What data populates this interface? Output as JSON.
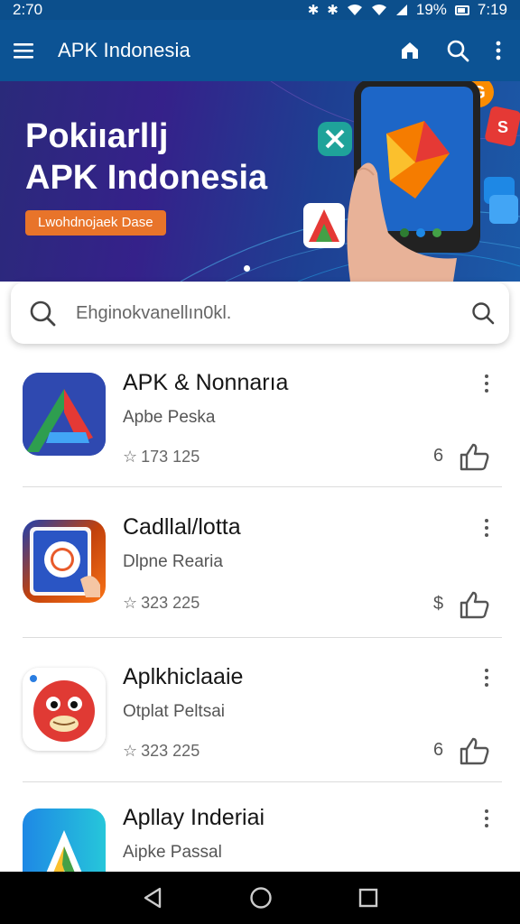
{
  "status_bar": {
    "time": "2:70",
    "battery_percent": "19%",
    "clock_right": "7:19"
  },
  "app_bar": {
    "title": "APK Indonesia"
  },
  "banner": {
    "title_line1": "Pokiıarllj",
    "title_line2": "APK Indonesia",
    "cta_label": "Lwohdnojaek Dase"
  },
  "search": {
    "placeholder": "Ehginokvanellın0kl."
  },
  "apps": [
    {
      "name": "APK & Nonnarıa",
      "developer": "Apbe Peska",
      "rating": "173 125",
      "price": "6",
      "icon": "geometric-a-icon"
    },
    {
      "name": "Cadllal/lotta",
      "developer": "Dlpne Rearia",
      "rating": "323 225",
      "price": "$",
      "icon": "camera-app-icon"
    },
    {
      "name": "Aplkhiclaaie",
      "developer": "Otplat Peltsai",
      "rating": "323 225",
      "price": "6",
      "icon": "red-bird-icon"
    },
    {
      "name": "Apllay Inderiai",
      "developer": "Aipke Passal",
      "rating": "",
      "price": "",
      "icon": "triangle-a-icon"
    }
  ],
  "colors": {
    "app_bar": "#0c5394",
    "cta": "#e8742a",
    "banner_start": "#2a2a7a",
    "banner_end": "#1b5aa8"
  },
  "nav": {
    "back": "back-icon",
    "home": "home-icon",
    "recents": "recents-icon"
  }
}
